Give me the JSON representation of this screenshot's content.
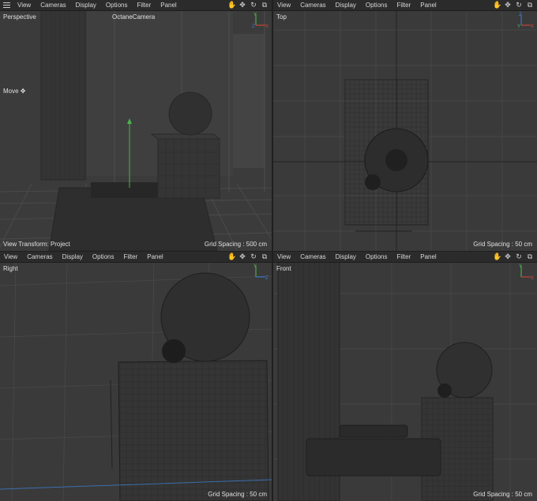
{
  "menu": [
    "View",
    "Cameras",
    "Display",
    "Options",
    "Filter",
    "Panel"
  ],
  "nav_icons": [
    "hand-icon",
    "move-icon",
    "rotate-icon",
    "maximize-icon"
  ],
  "viewports": {
    "perspective": {
      "name": "Perspective",
      "camera": "OctaneCamera",
      "tool": "Move",
      "transform": "View Transform: Project",
      "grid": "Grid Spacing : 500 cm"
    },
    "top": {
      "name": "Top",
      "grid": "Grid Spacing : 50 cm"
    },
    "right": {
      "name": "Right",
      "grid": "Grid Spacing : 50 cm"
    },
    "front": {
      "name": "Front",
      "grid": "Grid Spacing : 50 cm"
    }
  },
  "axis_colors": {
    "x": "#d9483b",
    "y": "#4fbf4f",
    "z": "#3a7fd9"
  },
  "axis_labels": {
    "x": "X",
    "y": "Y",
    "z": "Z"
  }
}
